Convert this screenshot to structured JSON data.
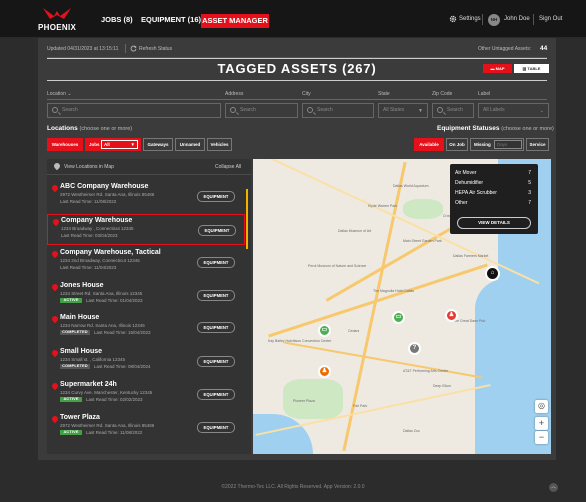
{
  "brand": {
    "logo_text": "PHOENIX"
  },
  "nav": {
    "jobs": "JOBS (8)",
    "equipment": "EQUIPMENT (16)",
    "asset_manager": "ASSET MANAGER"
  },
  "user": {
    "settings": "Settings",
    "initials": "NH",
    "name": "John Doe",
    "sign_out": "Sign Out"
  },
  "status": {
    "updated": "Updated 04/31/2023 at 13:15:11",
    "refresh": "Refresh Status",
    "untagged_label": "Other Untagged Assets:",
    "untagged_count": "44"
  },
  "title": "TAGGED ASSETS (267)",
  "view_toggle": {
    "map": "MAP",
    "table": "TABLE"
  },
  "filters": {
    "location_label": "Location",
    "address_label": "Address",
    "city_label": "City",
    "state_label": "State",
    "zip_label": "Zip Code",
    "label_label": "Label",
    "search_placeholder": "Search",
    "state_placeholder": "All States",
    "label_placeholder": "All Labels"
  },
  "locations": {
    "title": "Locations",
    "hint": "(choose one or more)",
    "chips": [
      "Warehouses",
      "Jobs",
      "All",
      "Gateways",
      "Unnamed",
      "Vehicles"
    ]
  },
  "equipment_statuses": {
    "title": "Equipment Statuses",
    "hint": "(choose one or more)",
    "chips": [
      "Available",
      "On Job",
      "Missing",
      "Days",
      "Service"
    ]
  },
  "list": {
    "view_in_map": "View Locations in Map",
    "collapse": "Collapse All",
    "equipment_btn": "EQUIPMENT",
    "items": [
      {
        "name": "ABC Company Warehouse",
        "addr": "2972 Westheimer Rd. Santa Ana, Illinois 85486",
        "read": "Last Read Time: 11/08/2022",
        "badge": ""
      },
      {
        "name": "Company Warehouse",
        "addr": "1234 Broadway , Connecticut 12345",
        "read": "Last Read Time: 03/04/2023",
        "badge": ""
      },
      {
        "name": "Company Warehouse, Tactical",
        "addr": "1234 2nd Broadway, Connecticut 12345",
        "read": "Last Read Time: 11/04/2023",
        "badge": ""
      },
      {
        "name": "Jones House",
        "addr": "1234 Street Rd. Santa Ana, Illinois 12345",
        "read": "Last Read Time: 01/04/2023",
        "badge": "ACTIVE"
      },
      {
        "name": "Main House",
        "addr": "1234 Narrow Rd. Santa Ana, Illinois 12345",
        "read": "Last Read Time: 15/04/2023",
        "badge": "COMPLETED"
      },
      {
        "name": "Small House",
        "addr": "1234 Small st. , California 12345",
        "read": "Last Read Time: 08/04/2024",
        "badge": "COMPLETED"
      },
      {
        "name": "Supermarket 24h",
        "addr": "1234 Curvy Ave. Manchester, Kentucky 12345",
        "read": "Last Read Time: 02/02/2023",
        "badge": "ACTIVE"
      },
      {
        "name": "Tower Plaza",
        "addr": "2972 Westheimer Rd. Santa Ana, Illinois 85486",
        "read": "Last Read Time: 11/08/2022",
        "badge": "ACTIVE"
      }
    ]
  },
  "popup": {
    "rows": [
      {
        "label": "Air Mover",
        "count": "7"
      },
      {
        "label": "Dehumidifier",
        "count": "5"
      },
      {
        "label": "HEPA Air Scrubber",
        "count": "3"
      },
      {
        "label": "Other",
        "count": "7"
      }
    ],
    "view_details": "VIEW DETAILS"
  },
  "map_labels": [
    "Dallas World Aquarium",
    "Crow Museum of Asian Art",
    "Dallas Museum of Art",
    "Klyde Warren Park",
    "Perot Museum of Nature and Science",
    "Main Street Garden Park",
    "Dallas Farmers Market",
    "The Magnolia Hotel Dallas",
    "Kay Bailey Hutchison Convention Center",
    "Pioneer Plaza",
    "AT&T Performing Arts Center",
    "Fair Park",
    "Deep Ellum",
    "The Great Dane Pub",
    "Dallas Zoo",
    "Cedars"
  ],
  "colors": {
    "accent": "#e4111b",
    "active_badge": "#43a047",
    "completed_badge": "#555555",
    "marker_green": "#4caf50",
    "marker_red": "#e53935",
    "marker_orange": "#ef6c00",
    "marker_grey": "#777777"
  },
  "footer": "©2022 Thermo-Tec LLC. All Rights Reserved. App Version: 2.0.0"
}
